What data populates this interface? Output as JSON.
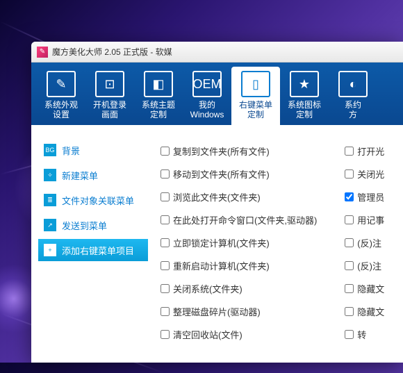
{
  "title": "魔方美化大师 2.05 正式版 - 软媒",
  "toolbar": [
    {
      "label": "系统外观\n设置",
      "icon": "✎"
    },
    {
      "label": "开机登录\n画面",
      "icon": "⊡"
    },
    {
      "label": "系统主题\n定制",
      "icon": "◧"
    },
    {
      "label": "我的\nWindows",
      "icon": "OEM"
    },
    {
      "label": "右键菜单\n定制",
      "icon": "▯",
      "active": true
    },
    {
      "label": "系统图标\n定制",
      "icon": "★"
    },
    {
      "label": "系约\n方",
      "icon": "◐"
    }
  ],
  "sidebar": [
    {
      "label": "背景",
      "icon": "BG"
    },
    {
      "label": "新建菜单",
      "icon": "✧"
    },
    {
      "label": "文件对象关联菜单",
      "icon": "≣"
    },
    {
      "label": "发送到菜单",
      "icon": "↗"
    },
    {
      "label": "添加右键菜单项目",
      "icon": "+",
      "active": true
    }
  ],
  "col1": [
    {
      "label": "复制到文件夹(所有文件)",
      "checked": false
    },
    {
      "label": "移动到文件夹(所有文件)",
      "checked": false
    },
    {
      "label": "浏览此文件夹(文件夹)",
      "checked": false
    },
    {
      "label": "在此处打开命令窗口(文件夹,驱动器)",
      "checked": false
    },
    {
      "label": "立即锁定计算机(文件夹)",
      "checked": false
    },
    {
      "label": "重新启动计算机(文件夹)",
      "checked": false
    },
    {
      "label": "关闭系统(文件夹)",
      "checked": false
    },
    {
      "label": "整理磁盘碎片(驱动器)",
      "checked": false
    },
    {
      "label": "清空回收站(文件)",
      "checked": false
    }
  ],
  "col2": [
    {
      "label": "打开光",
      "checked": false
    },
    {
      "label": "关闭光",
      "checked": false
    },
    {
      "label": "管理员",
      "checked": true
    },
    {
      "label": "用记事",
      "checked": false
    },
    {
      "label": "(反)注",
      "checked": false
    },
    {
      "label": "(反)注",
      "checked": false
    },
    {
      "label": "隐藏文",
      "checked": false
    },
    {
      "label": "隐藏文",
      "checked": false
    },
    {
      "label": "转",
      "checked": false
    }
  ]
}
